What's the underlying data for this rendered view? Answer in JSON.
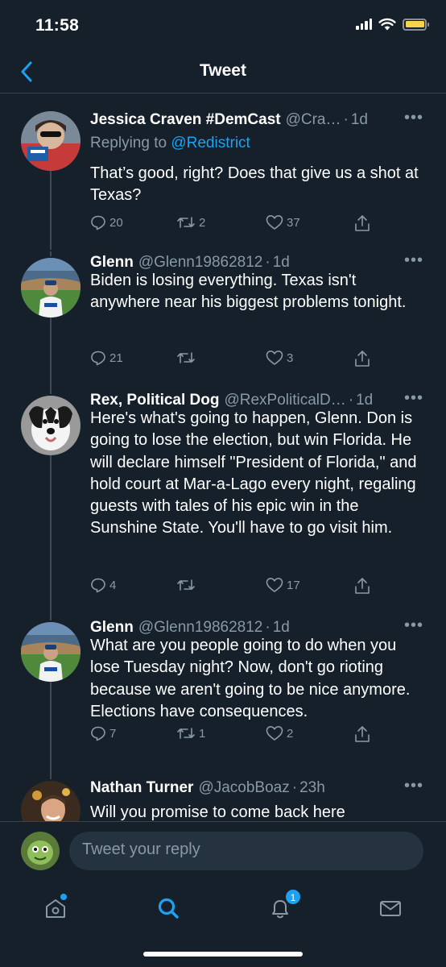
{
  "status_bar": {
    "time": "11:58"
  },
  "header": {
    "title": "Tweet"
  },
  "tweets": [
    {
      "name": "Jessica Craven #DemCast",
      "handle": "@Cra…",
      "time": "1d",
      "replying_label": "Replying to",
      "replying_handle": "@Redistrict",
      "text": "That’s good, right? Does that give us a shot at Texas?",
      "replies": "20",
      "retweets": "2",
      "likes": "37"
    },
    {
      "name": "Glenn",
      "handle": "@Glenn19862812",
      "time": "1d",
      "text": "Biden is losing everything. Texas isn't anywhere near his biggest problems tonight.",
      "replies": "21",
      "retweets": "",
      "likes": "3"
    },
    {
      "name": "Rex, Political Dog",
      "handle": "@RexPoliticalD…",
      "time": "1d",
      "text": "Here's what's going to happen, Glenn. Don is going to lose the election, but win Florida. He will declare himself \"President of Florida,\" and hold court at Mar-a-Lago every night, regaling guests with tales of his epic win in the Sunshine State. You'll have to go visit him.",
      "replies": "4",
      "retweets": "",
      "likes": "17"
    },
    {
      "name": "Glenn",
      "handle": "@Glenn19862812",
      "time": "1d",
      "text": "What are you people going to do when you lose Tuesday night? Now, don't go rioting because we aren't going to be nice anymore. Elections have consequences.",
      "replies": "7",
      "retweets": "1",
      "likes": "2"
    },
    {
      "name": "Nathan Turner",
      "handle": "@JacobBoaz",
      "time": "23h",
      "text": "Will you promise to come back here"
    }
  ],
  "reply_bar": {
    "placeholder": "Tweet your reply"
  },
  "tab_bar": {
    "notifications_count": "1"
  },
  "icons": {
    "back": "chevron-left-icon",
    "reply": "speech-bubble-icon",
    "retweet": "retweet-icon",
    "like": "heart-icon",
    "share": "share-icon",
    "more": "more-horizontal-icon",
    "home": "home-icon",
    "search": "search-icon",
    "notifications": "bell-icon",
    "messages": "envelope-icon"
  },
  "colors": {
    "background": "#15202b",
    "accent": "#1da1f2",
    "secondary_text": "#8899a6",
    "divider": "#38444d",
    "battery": "#f5d547"
  }
}
